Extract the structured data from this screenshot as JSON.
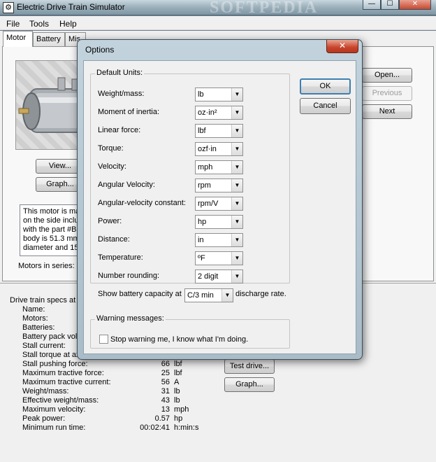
{
  "window": {
    "title": "Electric Drive Train Simulator",
    "watermark": "SOFTPEDIA",
    "min": "—",
    "max": "☐",
    "close": "✕"
  },
  "menu": [
    "File",
    "Tools",
    "Help"
  ],
  "tabs": [
    "Motor",
    "Battery",
    "Mis"
  ],
  "motor_panel": {
    "view_button": "View...",
    "graph_button": "Graph...",
    "open_button": "Open...",
    "previous_button": "Previous",
    "next_button": "Next",
    "description_lines": [
      "This motor is mac",
      "on the side incluc",
      "with the part #BF",
      "body is 51.3 mm",
      "diameter and 15"
    ],
    "motors_in_series_label": "Motors in series:"
  },
  "specs": {
    "header": "Drive train specs at 1",
    "test_drive_button": "Test drive...",
    "graph_button": "Graph...",
    "rows": [
      {
        "label": "Name:",
        "value": "",
        "unit": ""
      },
      {
        "label": "Motors:",
        "value": "",
        "unit": ""
      },
      {
        "label": "Batteries:",
        "value": "",
        "unit": ""
      },
      {
        "label": "Battery pack volt",
        "value": "",
        "unit": ""
      },
      {
        "label": "Stall current:",
        "value": "",
        "unit": ""
      },
      {
        "label": "Stall torque at ax",
        "value": "",
        "unit": ""
      },
      {
        "label": "Stall pushing force:",
        "value": "66",
        "unit": "lbf"
      },
      {
        "label": "Maximum tractive force:",
        "value": "25",
        "unit": "lbf"
      },
      {
        "label": "Maximum tractive current:",
        "value": "56",
        "unit": "A"
      },
      {
        "label": "Weight/mass:",
        "value": "31",
        "unit": "lb"
      },
      {
        "label": "Effective weight/mass:",
        "value": "43",
        "unit": "lb"
      },
      {
        "label": "Maximum velocity:",
        "value": "13",
        "unit": "mph"
      },
      {
        "label": "Peak power:",
        "value": "0.57",
        "unit": "hp"
      },
      {
        "label": "Minimum run time:",
        "value": "00:02:41",
        "unit": "h:min:s"
      }
    ]
  },
  "dialog": {
    "title": "Options",
    "close": "✕",
    "ok_button": "OK",
    "cancel_button": "Cancel",
    "default_units_caption": "Default Units:",
    "units": [
      {
        "label": "Weight/mass:",
        "value": "lb"
      },
      {
        "label": "Moment of inertia:",
        "value": "oz·in²"
      },
      {
        "label": "Linear force:",
        "value": "lbf"
      },
      {
        "label": "Torque:",
        "value": "ozf·in"
      },
      {
        "label": "Velocity:",
        "value": "mph"
      },
      {
        "label": "Angular Velocity:",
        "value": "rpm"
      },
      {
        "label": "Angular-velocity constant:",
        "value": "rpm/V"
      },
      {
        "label": "Power:",
        "value": "hp"
      },
      {
        "label": "Distance:",
        "value": "in"
      },
      {
        "label": "Temperature:",
        "value": "ºF"
      },
      {
        "label": "Number rounding:",
        "value": "2 digit"
      }
    ],
    "battery_prefix": "Show battery capacity at",
    "battery_value": "C/3 min",
    "battery_suffix": "discharge rate.",
    "warning_caption": "Warning messages:",
    "warning_checkbox_label": "Stop warning me, I know what I'm doing."
  },
  "icons": {
    "dropdown": "▼"
  }
}
